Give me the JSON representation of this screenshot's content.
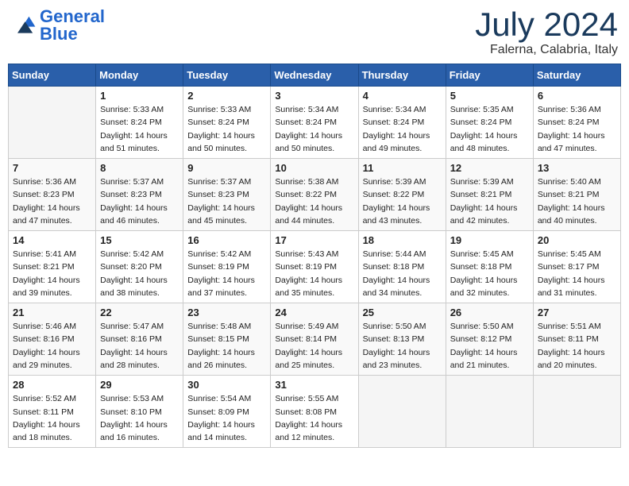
{
  "header": {
    "logo_general": "General",
    "logo_blue": "Blue",
    "month_title": "July 2024",
    "location": "Falerna, Calabria, Italy"
  },
  "days_of_week": [
    "Sunday",
    "Monday",
    "Tuesday",
    "Wednesday",
    "Thursday",
    "Friday",
    "Saturday"
  ],
  "weeks": [
    [
      {
        "day": "",
        "sunrise": "",
        "sunset": "",
        "daylight": ""
      },
      {
        "day": "1",
        "sunrise": "Sunrise: 5:33 AM",
        "sunset": "Sunset: 8:24 PM",
        "daylight": "Daylight: 14 hours and 51 minutes."
      },
      {
        "day": "2",
        "sunrise": "Sunrise: 5:33 AM",
        "sunset": "Sunset: 8:24 PM",
        "daylight": "Daylight: 14 hours and 50 minutes."
      },
      {
        "day": "3",
        "sunrise": "Sunrise: 5:34 AM",
        "sunset": "Sunset: 8:24 PM",
        "daylight": "Daylight: 14 hours and 50 minutes."
      },
      {
        "day": "4",
        "sunrise": "Sunrise: 5:34 AM",
        "sunset": "Sunset: 8:24 PM",
        "daylight": "Daylight: 14 hours and 49 minutes."
      },
      {
        "day": "5",
        "sunrise": "Sunrise: 5:35 AM",
        "sunset": "Sunset: 8:24 PM",
        "daylight": "Daylight: 14 hours and 48 minutes."
      },
      {
        "day": "6",
        "sunrise": "Sunrise: 5:36 AM",
        "sunset": "Sunset: 8:24 PM",
        "daylight": "Daylight: 14 hours and 47 minutes."
      }
    ],
    [
      {
        "day": "7",
        "sunrise": "Sunrise: 5:36 AM",
        "sunset": "Sunset: 8:23 PM",
        "daylight": "Daylight: 14 hours and 47 minutes."
      },
      {
        "day": "8",
        "sunrise": "Sunrise: 5:37 AM",
        "sunset": "Sunset: 8:23 PM",
        "daylight": "Daylight: 14 hours and 46 minutes."
      },
      {
        "day": "9",
        "sunrise": "Sunrise: 5:37 AM",
        "sunset": "Sunset: 8:23 PM",
        "daylight": "Daylight: 14 hours and 45 minutes."
      },
      {
        "day": "10",
        "sunrise": "Sunrise: 5:38 AM",
        "sunset": "Sunset: 8:22 PM",
        "daylight": "Daylight: 14 hours and 44 minutes."
      },
      {
        "day": "11",
        "sunrise": "Sunrise: 5:39 AM",
        "sunset": "Sunset: 8:22 PM",
        "daylight": "Daylight: 14 hours and 43 minutes."
      },
      {
        "day": "12",
        "sunrise": "Sunrise: 5:39 AM",
        "sunset": "Sunset: 8:21 PM",
        "daylight": "Daylight: 14 hours and 42 minutes."
      },
      {
        "day": "13",
        "sunrise": "Sunrise: 5:40 AM",
        "sunset": "Sunset: 8:21 PM",
        "daylight": "Daylight: 14 hours and 40 minutes."
      }
    ],
    [
      {
        "day": "14",
        "sunrise": "Sunrise: 5:41 AM",
        "sunset": "Sunset: 8:21 PM",
        "daylight": "Daylight: 14 hours and 39 minutes."
      },
      {
        "day": "15",
        "sunrise": "Sunrise: 5:42 AM",
        "sunset": "Sunset: 8:20 PM",
        "daylight": "Daylight: 14 hours and 38 minutes."
      },
      {
        "day": "16",
        "sunrise": "Sunrise: 5:42 AM",
        "sunset": "Sunset: 8:19 PM",
        "daylight": "Daylight: 14 hours and 37 minutes."
      },
      {
        "day": "17",
        "sunrise": "Sunrise: 5:43 AM",
        "sunset": "Sunset: 8:19 PM",
        "daylight": "Daylight: 14 hours and 35 minutes."
      },
      {
        "day": "18",
        "sunrise": "Sunrise: 5:44 AM",
        "sunset": "Sunset: 8:18 PM",
        "daylight": "Daylight: 14 hours and 34 minutes."
      },
      {
        "day": "19",
        "sunrise": "Sunrise: 5:45 AM",
        "sunset": "Sunset: 8:18 PM",
        "daylight": "Daylight: 14 hours and 32 minutes."
      },
      {
        "day": "20",
        "sunrise": "Sunrise: 5:45 AM",
        "sunset": "Sunset: 8:17 PM",
        "daylight": "Daylight: 14 hours and 31 minutes."
      }
    ],
    [
      {
        "day": "21",
        "sunrise": "Sunrise: 5:46 AM",
        "sunset": "Sunset: 8:16 PM",
        "daylight": "Daylight: 14 hours and 29 minutes."
      },
      {
        "day": "22",
        "sunrise": "Sunrise: 5:47 AM",
        "sunset": "Sunset: 8:16 PM",
        "daylight": "Daylight: 14 hours and 28 minutes."
      },
      {
        "day": "23",
        "sunrise": "Sunrise: 5:48 AM",
        "sunset": "Sunset: 8:15 PM",
        "daylight": "Daylight: 14 hours and 26 minutes."
      },
      {
        "day": "24",
        "sunrise": "Sunrise: 5:49 AM",
        "sunset": "Sunset: 8:14 PM",
        "daylight": "Daylight: 14 hours and 25 minutes."
      },
      {
        "day": "25",
        "sunrise": "Sunrise: 5:50 AM",
        "sunset": "Sunset: 8:13 PM",
        "daylight": "Daylight: 14 hours and 23 minutes."
      },
      {
        "day": "26",
        "sunrise": "Sunrise: 5:50 AM",
        "sunset": "Sunset: 8:12 PM",
        "daylight": "Daylight: 14 hours and 21 minutes."
      },
      {
        "day": "27",
        "sunrise": "Sunrise: 5:51 AM",
        "sunset": "Sunset: 8:11 PM",
        "daylight": "Daylight: 14 hours and 20 minutes."
      }
    ],
    [
      {
        "day": "28",
        "sunrise": "Sunrise: 5:52 AM",
        "sunset": "Sunset: 8:11 PM",
        "daylight": "Daylight: 14 hours and 18 minutes."
      },
      {
        "day": "29",
        "sunrise": "Sunrise: 5:53 AM",
        "sunset": "Sunset: 8:10 PM",
        "daylight": "Daylight: 14 hours and 16 minutes."
      },
      {
        "day": "30",
        "sunrise": "Sunrise: 5:54 AM",
        "sunset": "Sunset: 8:09 PM",
        "daylight": "Daylight: 14 hours and 14 minutes."
      },
      {
        "day": "31",
        "sunrise": "Sunrise: 5:55 AM",
        "sunset": "Sunset: 8:08 PM",
        "daylight": "Daylight: 14 hours and 12 minutes."
      },
      {
        "day": "",
        "sunrise": "",
        "sunset": "",
        "daylight": ""
      },
      {
        "day": "",
        "sunrise": "",
        "sunset": "",
        "daylight": ""
      },
      {
        "day": "",
        "sunrise": "",
        "sunset": "",
        "daylight": ""
      }
    ]
  ]
}
